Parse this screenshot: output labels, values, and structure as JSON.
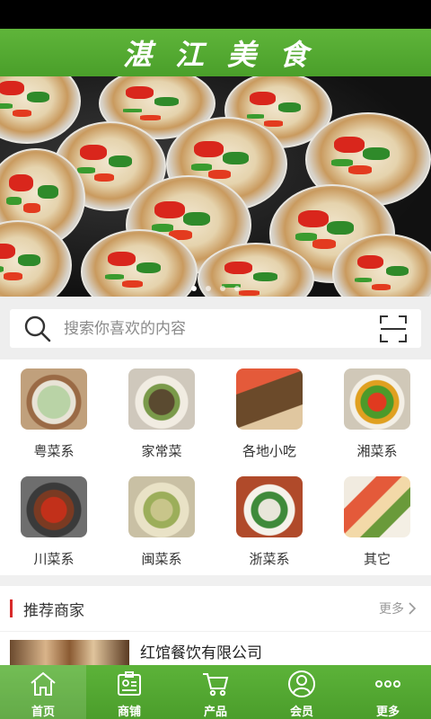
{
  "header": {
    "title": "湛江美食"
  },
  "banner": {
    "slide_count": 4,
    "active_index": 0
  },
  "search": {
    "placeholder": "搜索你喜欢的内容"
  },
  "categories": [
    {
      "label": "粤菜系",
      "icon": "soup-bowl"
    },
    {
      "label": "家常菜",
      "icon": "stir-fry-bowl"
    },
    {
      "label": "各地小吃",
      "icon": "noodles-plate"
    },
    {
      "label": "湘菜系",
      "icon": "pepper-dish"
    },
    {
      "label": "川菜系",
      "icon": "hotpot"
    },
    {
      "label": "闽菜系",
      "icon": "clam-plate"
    },
    {
      "label": "浙菜系",
      "icon": "garnished-plate"
    },
    {
      "label": "其它",
      "icon": "sushi-platter"
    }
  ],
  "recommend": {
    "title": "推荐商家",
    "more_label": "更多"
  },
  "merchants": [
    {
      "name": "红馆餐饮有限公司"
    }
  ],
  "tabbar": [
    {
      "label": "首页",
      "icon": "home-icon"
    },
    {
      "label": "商铺",
      "icon": "store-badge-icon"
    },
    {
      "label": "产品",
      "icon": "cart-icon"
    },
    {
      "label": "会员",
      "icon": "user-icon"
    },
    {
      "label": "更多",
      "icon": "more-icon"
    }
  ],
  "colors": {
    "primary_green": "#4fa52e",
    "accent_red": "#d82a2a"
  }
}
